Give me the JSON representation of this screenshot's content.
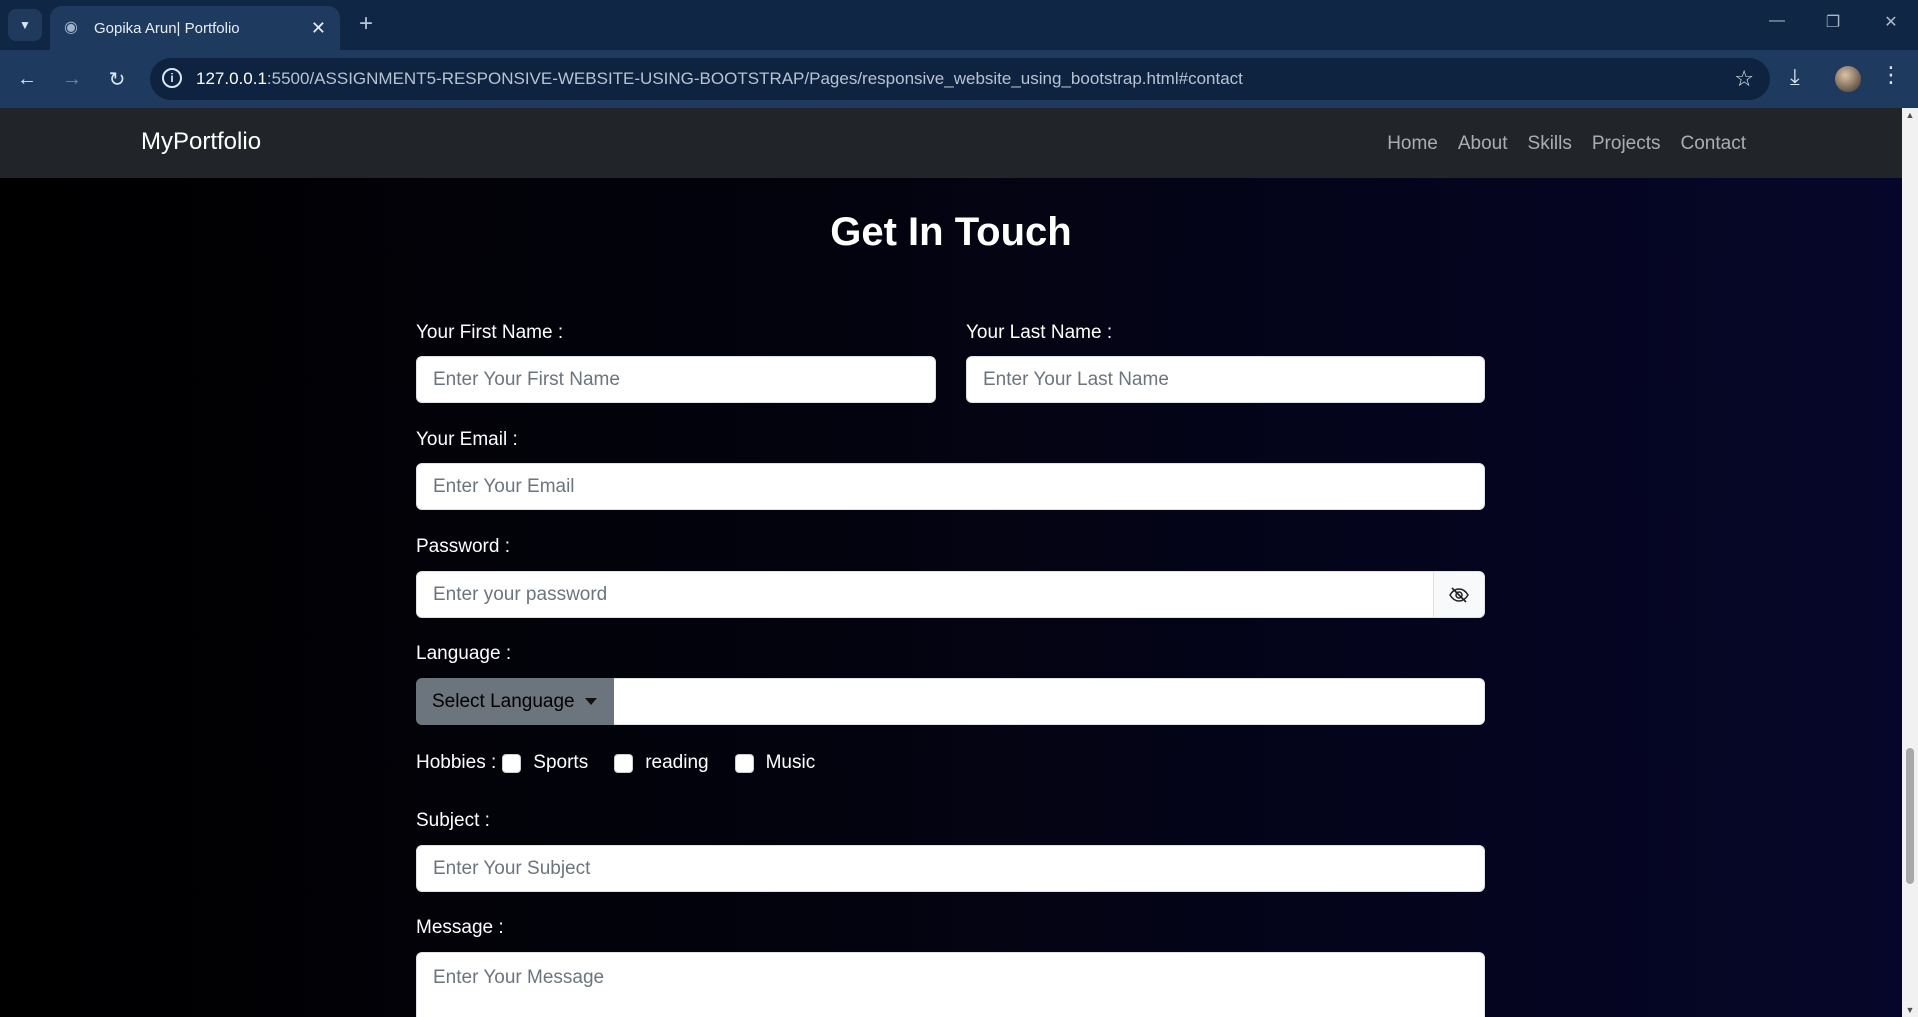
{
  "browser": {
    "tab_title": "Gopika Arun| Portfolio",
    "url_host": "127.0.0.1",
    "url_rest": ":5500/ASSIGNMENT5-RESPONSIVE-WEBSITE-USING-BOOTSTRAP/Pages/responsive_website_using_bootstrap.html#contact"
  },
  "navbar": {
    "brand": "MyPortfolio",
    "links": [
      "Home",
      "About",
      "Skills",
      "Projects",
      "Contact"
    ]
  },
  "contact": {
    "heading": "Get In Touch",
    "first_name_label": "Your First Name :",
    "first_name_placeholder": "Enter Your First Name",
    "last_name_label": "Your Last Name :",
    "last_name_placeholder": "Enter Your Last Name",
    "email_label": "Your Email :",
    "email_placeholder": "Enter Your Email",
    "password_label": "Password :",
    "password_placeholder": "Enter your password",
    "language_label": "Language :",
    "language_button": "Select Language",
    "hobbies_label": "Hobbies :",
    "hobbies": [
      "Sports",
      "reading",
      "Music"
    ],
    "subject_label": "Subject :",
    "subject_placeholder": "Enter Your Subject",
    "message_label": "Message :",
    "message_placeholder": "Enter Your Message"
  }
}
